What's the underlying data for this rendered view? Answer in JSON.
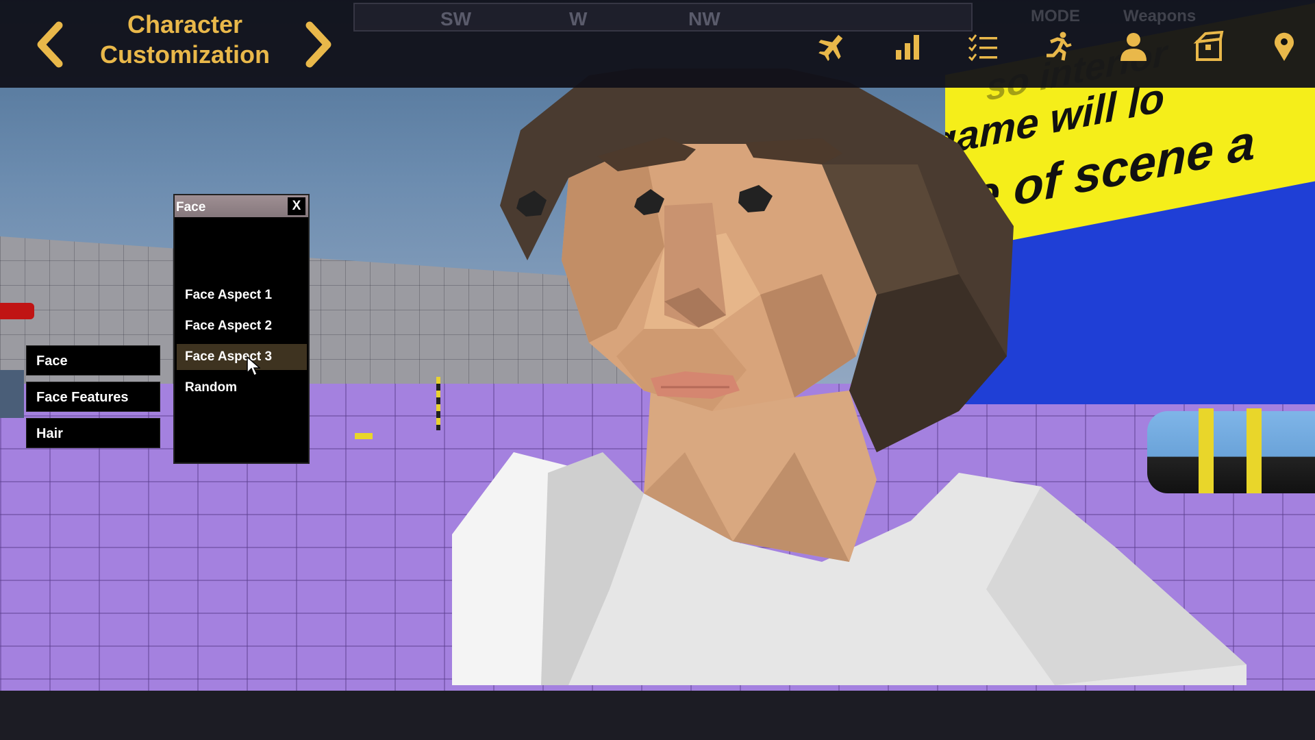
{
  "header": {
    "title_line1": "Character",
    "title_line2": "Customization"
  },
  "compass": {
    "headings": [
      "SW",
      "W",
      "NW"
    ]
  },
  "hud_icons": [
    "airplane-icon",
    "stats-bar-icon",
    "checklist-icon",
    "running-person-icon",
    "profile-icon",
    "box-icon",
    "map-pin-icon"
  ],
  "ghost_tabs": [
    "MODE",
    "Weapons"
  ],
  "scene_banner": {
    "line1": "game will lo",
    "line2": "e of scene a",
    "line3": "so interior"
  },
  "categories": [
    {
      "label": "Face"
    },
    {
      "label": "Face Features"
    },
    {
      "label": "Hair"
    }
  ],
  "face_panel": {
    "title": "Face",
    "close_label": "X",
    "options": [
      {
        "label": "Face Aspect 1",
        "selected": false
      },
      {
        "label": "Face Aspect 2",
        "selected": false
      },
      {
        "label": "Face Aspect 3",
        "selected": true
      },
      {
        "label": "Random",
        "selected": false
      }
    ]
  },
  "colors": {
    "accent_gold": "#e9b84a",
    "floor_purple": "#a481df",
    "banner_yellow": "#f5ee1a",
    "wall_blue": "#1f3fd6"
  }
}
